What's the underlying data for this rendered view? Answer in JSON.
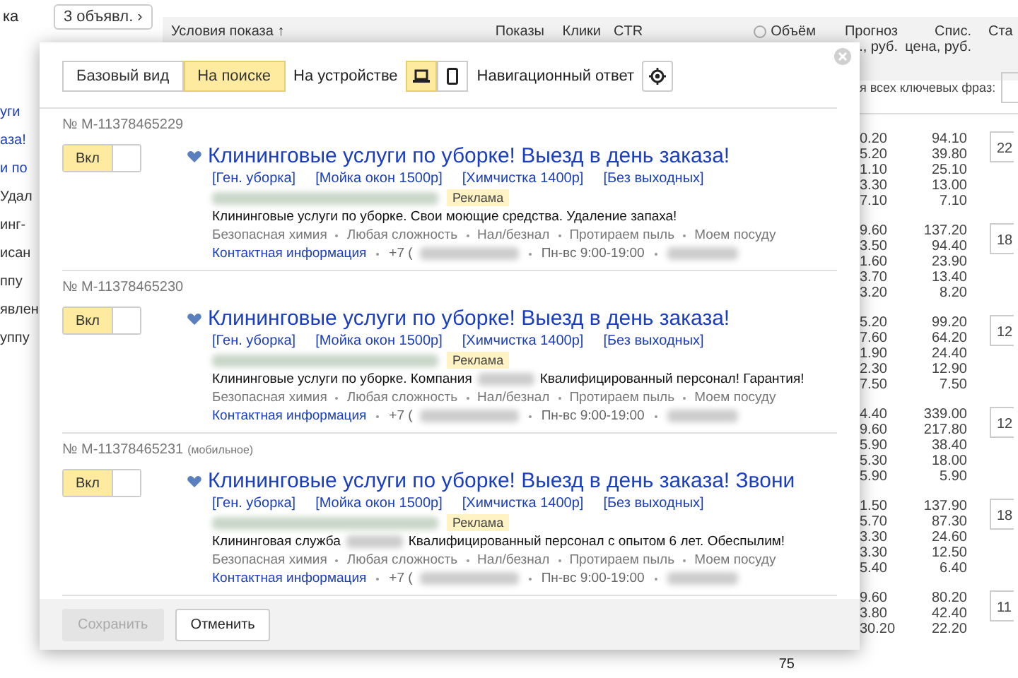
{
  "background_page": {
    "left_column": [
      "ка",
      "уги",
      "аза!",
      "и по",
      "Удал",
      "инг-",
      "исан",
      "ппу",
      "явлен",
      "уппу"
    ],
    "ads_button": "3 объявл. ›",
    "table_header": [
      "Условия показа ↑",
      "Показы",
      "Клики",
      "CTR",
      "Объём",
      "Прогноз",
      "., руб.",
      "Спис. цена, руб.",
      "Ста"
    ],
    "bid_for_all_label": "я всех ключевых фраз:",
    "groups": [
      {
        "column_1": [
          "0.20",
          "5.20",
          "1.10",
          "3.30",
          "7.10"
        ],
        "column_2": [
          "94.10",
          "39.80",
          "25.10",
          "13.00",
          "7.10"
        ],
        "bid": "22"
      },
      {
        "column_1": [
          "9.60",
          "3.50",
          "1.60",
          "3.70",
          "3.20"
        ],
        "column_2": [
          "137.20",
          "94.40",
          "23.90",
          "13.40",
          "8.20"
        ],
        "bid": "18"
      },
      {
        "column_1": [
          "5.20",
          "7.60",
          "1.90",
          "2.30",
          "7.50"
        ],
        "column_2": [
          "99.20",
          "64.20",
          "24.40",
          "12.90",
          "7.50"
        ],
        "bid": "12"
      },
      {
        "column_1": [
          "4.40",
          "9.60",
          "5.90",
          "5.30",
          "5.90"
        ],
        "column_2": [
          "339.00",
          "217.80",
          "38.40",
          "18.00",
          "5.90"
        ],
        "bid": "12"
      },
      {
        "column_1": [
          "1.50",
          "5.70",
          "3.30",
          "3.30",
          "5.40"
        ],
        "column_2": [
          "137.90",
          "87.30",
          "24.60",
          "12.50",
          "6.40"
        ],
        "bid": "18"
      },
      {
        "column_1": [
          "9.60",
          "3.80",
          "30.20"
        ],
        "column_2": [
          "80.20",
          "42.40",
          "22.20"
        ],
        "bid": "11"
      }
    ],
    "bottom_count": "75"
  },
  "dialog": {
    "view_tabs": [
      {
        "label": "Базовый вид",
        "selected": false
      },
      {
        "label": "На поиске",
        "selected": true
      }
    ],
    "device_label": "На устройстве",
    "devices": [
      {
        "kind": "desktop",
        "selected": true
      },
      {
        "kind": "mobile",
        "selected": false
      }
    ],
    "nav_answer_label": "Навигационный ответ",
    "ads": [
      {
        "number": "№ M-11378465229",
        "on": true,
        "toggle_label": "Вкл",
        "title": "Клининговые услуги по уборке! Выезд в день заказа!",
        "sitelinks": [
          "[Ген. уборка]",
          "[Мойка окон 1500р]",
          "[Химчистка 1400р]",
          "[Без выходных]"
        ],
        "ad_label": "Реклама",
        "text_parts": [
          {
            "kind": "text",
            "text": "Клининговые услуги по уборке. Свои моющие средства. Удаление запаха!"
          }
        ],
        "callouts": [
          "Безопасная химия",
          "Любая сложность",
          "Нал/безнал",
          "Протираем пыль",
          "Моем посуду"
        ],
        "contact_link": "Контактная информация",
        "phone": "+7 (",
        "hours": "Пн-вс 9:00-19:00"
      },
      {
        "number": "№ M-11378465230",
        "on": true,
        "toggle_label": "Вкл",
        "title": "Клининговые услуги по уборке! Выезд в день заказа!",
        "sitelinks": [
          "[Ген. уборка]",
          "[Мойка окон 1500р]",
          "[Химчистка 1400р]",
          "[Без выходных]"
        ],
        "ad_label": "Реклама",
        "text_parts": [
          {
            "kind": "text",
            "text": "Клининговые услуги по уборке. Компания"
          },
          {
            "kind": "blur"
          },
          {
            "kind": "text",
            "text": "Квалифицированный персонал! Гарантия!"
          }
        ],
        "callouts": [
          "Безопасная химия",
          "Любая сложность",
          "Нал/безнал",
          "Протираем пыль",
          "Моем посуду"
        ],
        "contact_link": "Контактная информация",
        "phone": "+7 (",
        "hours": "Пн-вс 9:00-19:00"
      },
      {
        "number": "№ M-11378465231",
        "note": "(мобильное)",
        "on": true,
        "toggle_label": "Вкл",
        "title": "Клининговые услуги по уборке! Выезд в день заказа! Звони",
        "sitelinks": [
          "[Ген. уборка]",
          "[Мойка окон 1500р]",
          "[Химчистка 1400р]",
          "[Без выходных]"
        ],
        "ad_label": "Реклама",
        "text_parts": [
          {
            "kind": "text",
            "text": "Клининговая служба"
          },
          {
            "kind": "blur"
          },
          {
            "kind": "text",
            "text": "Квалифицированный персонал с опытом 6 лет. Обеспылим!"
          }
        ],
        "callouts": [
          "Безопасная химия",
          "Любая сложность",
          "Нал/безнал",
          "Протираем пыль",
          "Моем посуду"
        ],
        "contact_link": "Контактная информация",
        "phone": "+7 (",
        "hours": "Пн-вс 9:00-19:00"
      }
    ],
    "save_button": {
      "label": "Сохранить",
      "disabled": true
    },
    "cancel_button": "Отменить"
  }
}
